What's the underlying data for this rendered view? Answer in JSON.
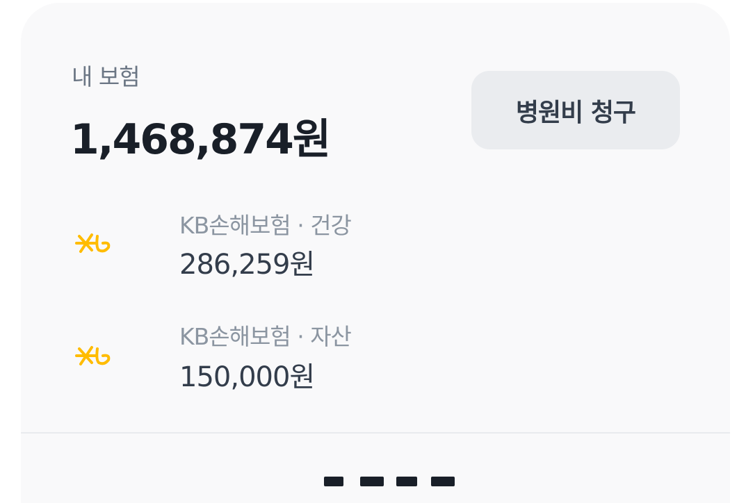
{
  "summary": {
    "label": "내 보험",
    "total": "1,468,874원"
  },
  "claim_button": {
    "label": "병원비 청구"
  },
  "policies": [
    {
      "logo": "kb-logo-icon",
      "name": "KB손해보험 · 건강",
      "amount": "286,259원"
    },
    {
      "logo": "kb-logo-icon",
      "name": "KB손해보험 · 자산",
      "amount": "150,000원"
    }
  ],
  "colors": {
    "card_background": "#f9f9fa",
    "button_background": "#eaecef",
    "kb_logo": "#ffbc00",
    "primary_text": "#191f28",
    "secondary_text": "#8b95a1"
  }
}
